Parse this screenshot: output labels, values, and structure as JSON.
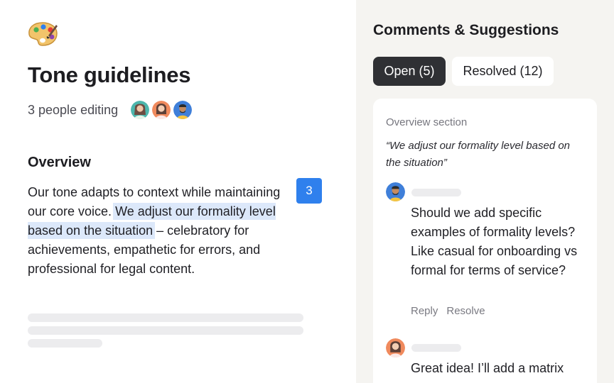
{
  "document": {
    "icon": "artist-palette-icon",
    "title": "Tone guidelines",
    "editing_text": "3 people editing",
    "avatars": [
      "collaborator-avatar-1",
      "collaborator-avatar-2",
      "collaborator-avatar-3"
    ],
    "section_heading": "Overview",
    "paragraph_before": "Our tone adapts to context while maintaining our core voice. ",
    "paragraph_highlight": "We adjust our formality level based on the situation",
    "paragraph_after": " – celebratory for achievements, empathetic for errors, and professional for legal content.",
    "comment_count": "3",
    "colors": {
      "highlight": "#dce8fa",
      "badge": "#2f80ed"
    }
  },
  "panel": {
    "title": "Comments & Suggestions",
    "tabs": [
      {
        "label": "Open (5)",
        "active": true
      },
      {
        "label": "Resolved (12)",
        "active": false
      }
    ],
    "thread": {
      "section": "Overview section",
      "quote": "“We adjust our formality level based on the situation”",
      "comments": [
        {
          "avatar": "commenter-avatar",
          "text": "Should we add specific examples of formality levels? Like casual for onboarding vs formal for terms of service?",
          "reply_label": "Reply",
          "resolve_label": "Resolve"
        },
        {
          "avatar": "commenter-avatar",
          "text": "Great idea! I’ll add a matrix"
        }
      ]
    },
    "colors": {
      "panel_bg": "#f5f4f1",
      "active_tab": "#2f3034"
    }
  }
}
